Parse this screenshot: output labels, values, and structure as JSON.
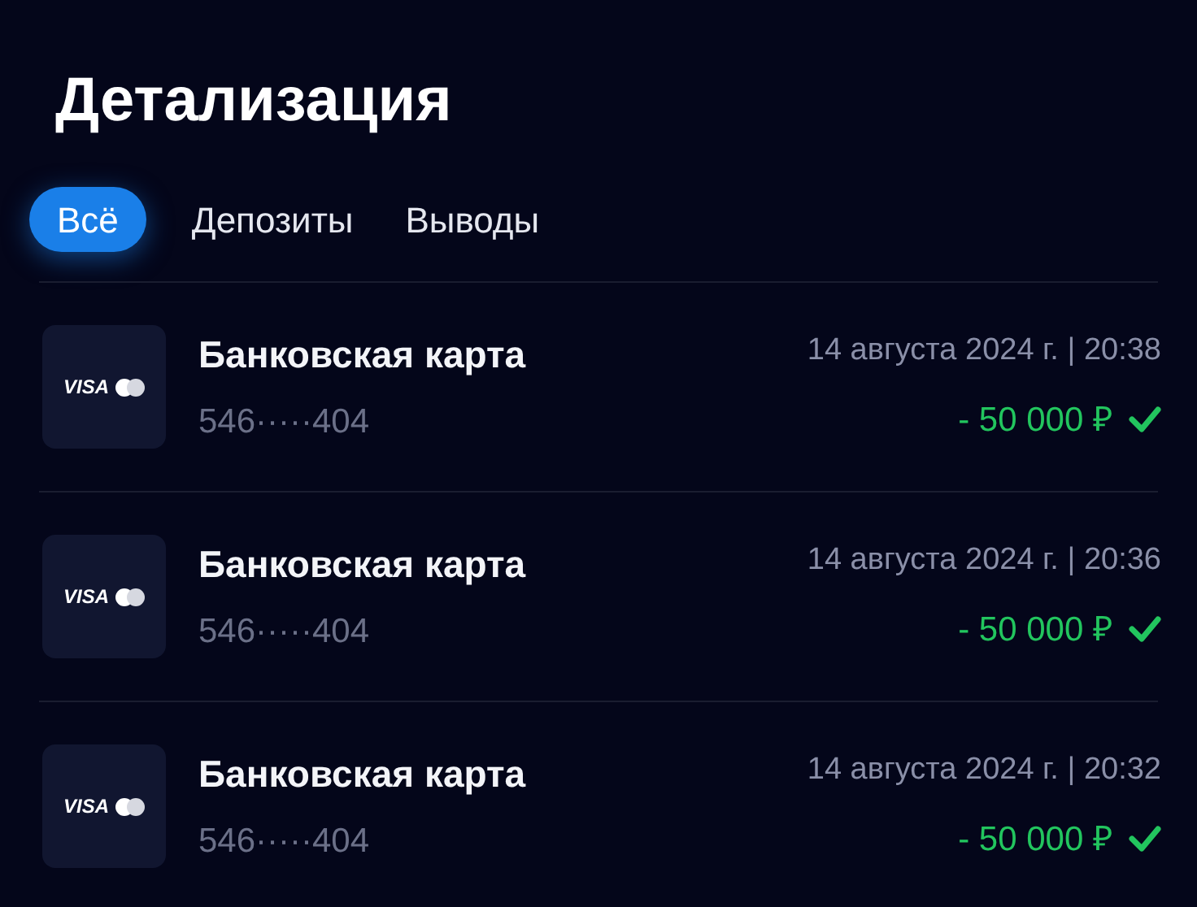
{
  "title": "Детализация",
  "tabs": [
    {
      "label": "Всё",
      "selected": true
    },
    {
      "label": "Депозиты",
      "selected": false
    },
    {
      "label": "Выводы",
      "selected": false
    }
  ],
  "transactions": [
    {
      "logo_text": "VISA",
      "name": "Банковская карта",
      "card": "546·····404",
      "date": "14 августа 2024 г. | 20:38",
      "amount": "- 50 000 ₽",
      "completed": true
    },
    {
      "logo_text": "VISA",
      "name": "Банковская карта",
      "card": "546·····404",
      "date": "14 августа 2024 г. | 20:36",
      "amount": "- 50 000 ₽",
      "completed": true
    },
    {
      "logo_text": "VISA",
      "name": "Банковская карта",
      "card": "546·····404",
      "date": "14 августа 2024 г. | 20:32",
      "amount": "- 50 000 ₽",
      "completed": true
    }
  ]
}
